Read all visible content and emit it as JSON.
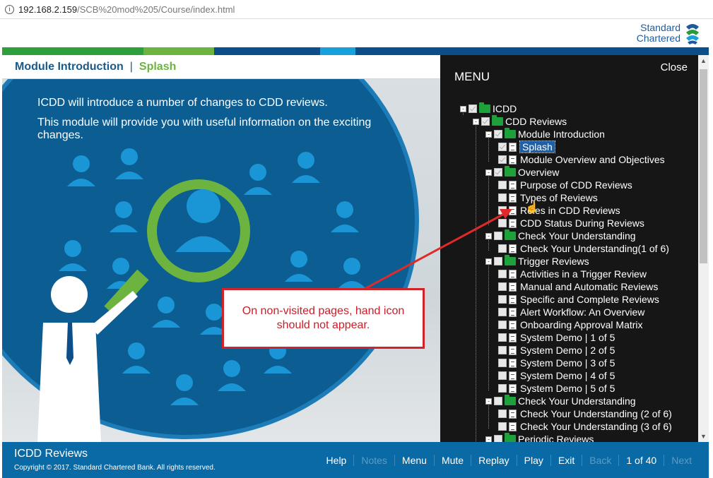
{
  "browser": {
    "url_host": "192.168.2.159",
    "url_path": "/SCB%20mod%205/Course/index.html"
  },
  "brand": {
    "line1": "Standard",
    "line2": "Chartered",
    "colors": [
      "#6cb43f",
      "#5aa632",
      "#0b4e8a",
      "#17a0dc",
      "#0b6aa5"
    ]
  },
  "breadcrumb": {
    "module": "Module Introduction",
    "separator": "|",
    "page": "Splash"
  },
  "content": {
    "p1": "ICDD will introduce a number of changes to CDD reviews.",
    "p2": "This module will provide you with useful information on the exciting changes."
  },
  "callout": {
    "text": "On non-visited pages, hand icon should not appear."
  },
  "menu": {
    "title": "MENU",
    "close": "Close",
    "items": [
      {
        "label": "ICDD",
        "type": "folder"
      },
      {
        "label": "CDD Reviews",
        "type": "folder"
      },
      {
        "label": "Module Introduction",
        "type": "folder"
      },
      {
        "label": "Splash",
        "type": "page",
        "selected": true
      },
      {
        "label": "Module Overview and Objectives",
        "type": "page"
      },
      {
        "label": "Overview",
        "type": "folder"
      },
      {
        "label": "Purpose of CDD Reviews",
        "type": "page"
      },
      {
        "label": "Types of Reviews",
        "type": "page"
      },
      {
        "label": "Roles in CDD Reviews",
        "type": "page"
      },
      {
        "label": "CDD Status During Reviews",
        "type": "page"
      },
      {
        "label": "Check Your Understanding",
        "type": "folder"
      },
      {
        "label": "Check Your Understanding(1 of 6)",
        "type": "page"
      },
      {
        "label": "Trigger Reviews",
        "type": "folder"
      },
      {
        "label": "Activities in a Trigger Review",
        "type": "page"
      },
      {
        "label": "Manual and Automatic Reviews",
        "type": "page"
      },
      {
        "label": "Specific and Complete Reviews",
        "type": "page"
      },
      {
        "label": "Alert Workflow: An Overview",
        "type": "page"
      },
      {
        "label": "Onboarding Approval Matrix",
        "type": "page"
      },
      {
        "label": "System Demo | 1 of 5",
        "type": "page"
      },
      {
        "label": "System Demo | 2 of 5",
        "type": "page"
      },
      {
        "label": "System Demo | 3 of 5",
        "type": "page"
      },
      {
        "label": "System Demo | 4 of 5",
        "type": "page"
      },
      {
        "label": "System Demo | 5 of 5",
        "type": "page"
      },
      {
        "label": "Check Your Understanding",
        "type": "folder"
      },
      {
        "label": "Check Your Understanding (2 of 6)",
        "type": "page"
      },
      {
        "label": "Check Your Understanding (3 of 6)",
        "type": "page"
      },
      {
        "label": "Periodic Reviews",
        "type": "folder"
      }
    ]
  },
  "footer": {
    "title": "ICDD Reviews",
    "copyright": "Copyright © 2017. Standard Chartered Bank. All rights reserved.",
    "help": "Help",
    "notes": "Notes",
    "menu": "Menu",
    "mute": "Mute",
    "replay": "Replay",
    "play": "Play",
    "exit": "Exit",
    "back": "Back",
    "page_counter": "1 of 40",
    "next": "Next"
  }
}
